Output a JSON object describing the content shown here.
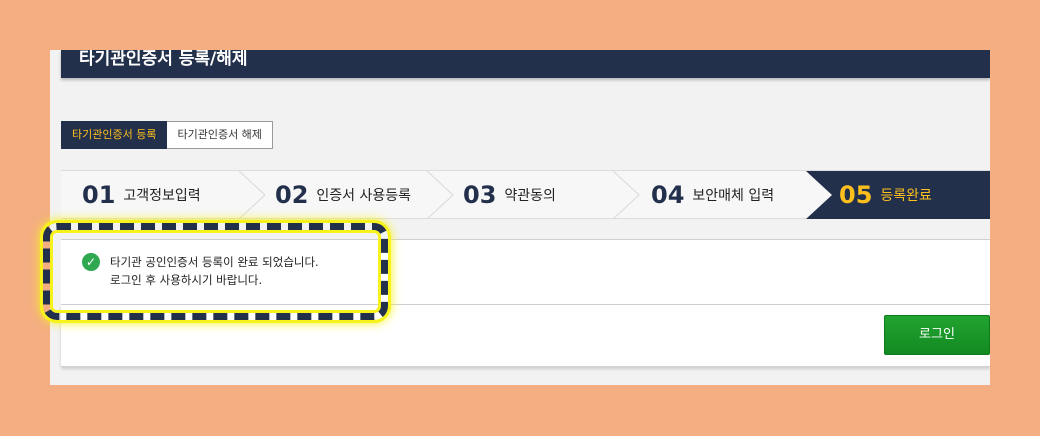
{
  "header": {
    "title": "타기관인증서 등록/해제"
  },
  "tabs": [
    {
      "label": "타기관인증서 등록"
    },
    {
      "label": "타기관인증서 해제"
    }
  ],
  "steps": [
    {
      "num": "01",
      "label": "고객정보입력"
    },
    {
      "num": "02",
      "label": "인증서 사용등록"
    },
    {
      "num": "03",
      "label": "약관동의"
    },
    {
      "num": "04",
      "label": "보안매체 입력"
    },
    {
      "num": "05",
      "label": "등록완료"
    }
  ],
  "message": {
    "line1": "타기관 공인인증서 등록이 완료 되었습니다.",
    "line2": "로그인 후 사용하시기 바랍니다."
  },
  "buttons": {
    "login": "로그인"
  },
  "colors": {
    "navy": "#23304b",
    "accent": "#ffc01e",
    "green": "#2fa84f",
    "highlight": "#f7f21a"
  }
}
